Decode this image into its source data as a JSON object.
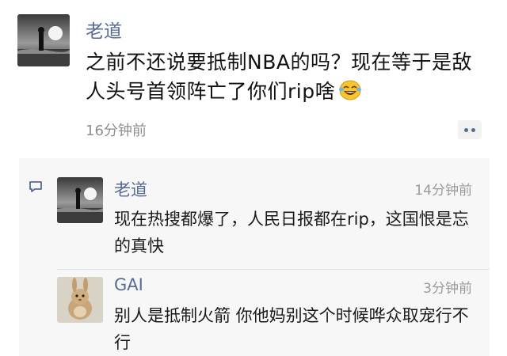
{
  "post": {
    "author": "老道",
    "text": "之前不还说要抵制NBA的吗？现在等于是敌人头号首领阵亡了你们rip啥",
    "emoji": "laugh-tears-icon",
    "time": "16分钟前"
  },
  "comments": [
    {
      "author": "老道",
      "time": "14分钟前",
      "text": "现在热搜都爆了，人民日报都在rip，这国恨是忘的真快"
    },
    {
      "author": "GAI",
      "time": "3分钟前",
      "text": "别人是抵制火箭 你他妈别这个时候哗众取宠行不行"
    }
  ],
  "colors": {
    "name_link": "#576b95",
    "comment_bg": "#f7f7f7",
    "time_text": "#8f8f8f"
  }
}
